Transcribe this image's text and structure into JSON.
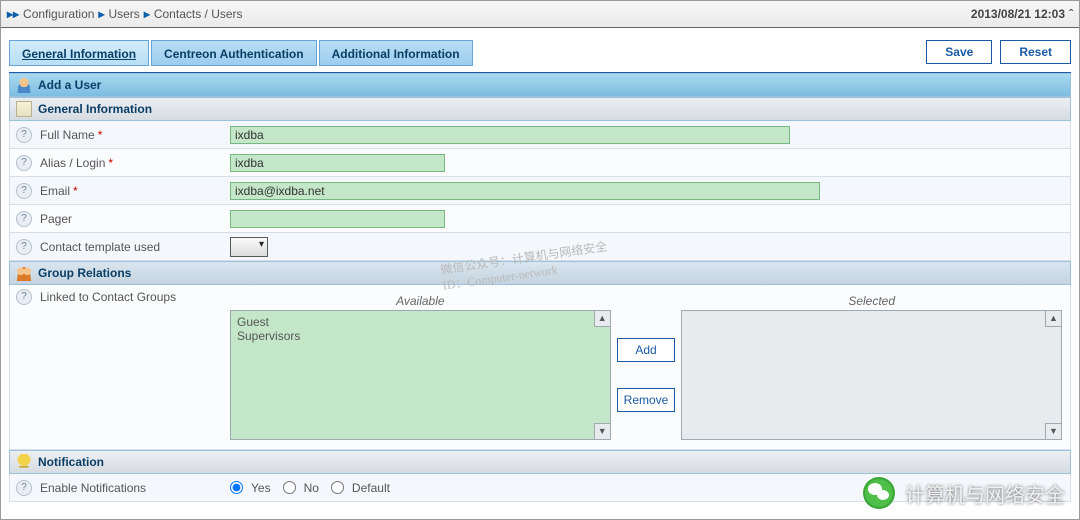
{
  "breadcrumb": {
    "root": "Configuration",
    "level1": "Users",
    "level2": "Contacts / Users",
    "timestamp": "2013/08/21 12:03"
  },
  "actions": {
    "save": "Save",
    "reset": "Reset"
  },
  "tabs": {
    "general": "General Information",
    "auth": "Centreon Authentication",
    "additional": "Additional Information"
  },
  "title": "Add a User",
  "section_general": "General Information",
  "fields": {
    "full_name": {
      "label": "Full Name",
      "required": true,
      "value": "ixdba"
    },
    "alias": {
      "label": "Alias / Login",
      "required": true,
      "value": "ixdba"
    },
    "email": {
      "label": "Email",
      "required": true,
      "value": "ixdba@ixdba.net"
    },
    "pager": {
      "label": "Pager",
      "required": false,
      "value": ""
    },
    "template": {
      "label": "Contact template used",
      "required": false
    }
  },
  "section_groups": "Group Relations",
  "groups": {
    "label": "Linked to Contact Groups",
    "available_hdr": "Available",
    "selected_hdr": "Selected",
    "available": [
      "Guest",
      "Supervisors"
    ],
    "selected": [],
    "add_btn": "Add",
    "remove_btn": "Remove"
  },
  "section_notif": "Notification",
  "notif": {
    "label": "Enable Notifications",
    "opt_yes": "Yes",
    "opt_no": "No",
    "opt_default": "Default",
    "value": "Yes"
  },
  "watermark": {
    "line1": "微信公众号：计算机与网络安全",
    "line2": "ID：Computer-network"
  },
  "footer_badge": "计算机与网络安全"
}
